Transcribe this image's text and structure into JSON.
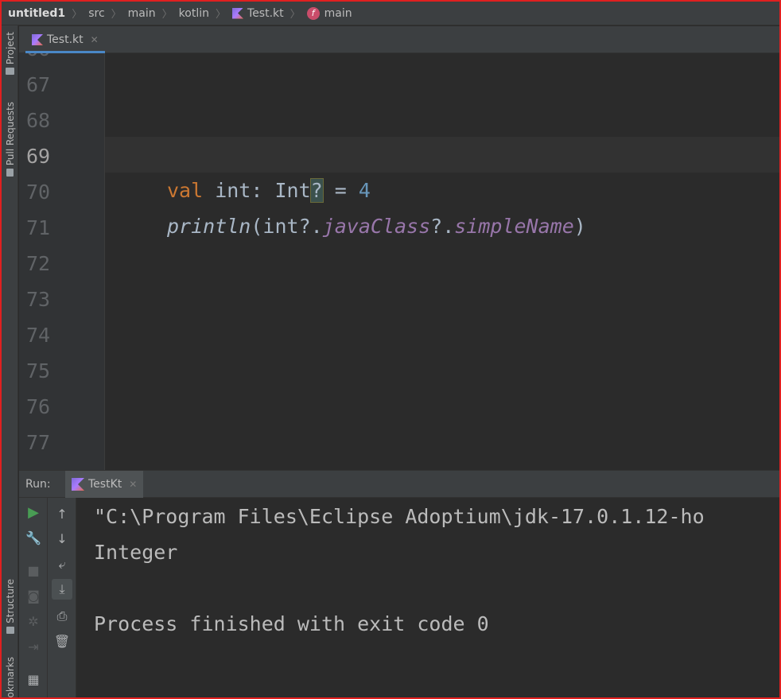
{
  "breadcrumb": {
    "project": "untitled1",
    "items": [
      "src",
      "main",
      "kotlin",
      "Test.kt",
      "main"
    ]
  },
  "left_tool_windows": [
    "Project",
    "Pull Requests",
    "Structure",
    "ookmarks"
  ],
  "editor": {
    "tab_label": "Test.kt",
    "line_numbers": [
      "67",
      "68",
      "69",
      "70",
      "71",
      "72",
      "73",
      "74",
      "75",
      "76",
      "77"
    ],
    "current_line": "69",
    "code": {
      "line70": {
        "kw": "val",
        "name": " int: Int",
        "highlight": "?",
        "rest": " = ",
        "value": "4"
      },
      "line71": {
        "fn": "println",
        "open": "(int?.",
        "prop1": "javaClass",
        "mid": "?.",
        "prop2": "simpleName",
        "close": ")"
      }
    }
  },
  "run_panel": {
    "label": "Run:",
    "tab_label": "TestKt",
    "console_lines": [
      "\"C:\\Program Files\\Eclipse Adoptium\\jdk-17.0.1.12-ho",
      "Integer",
      "",
      "Process finished with exit code 0"
    ]
  },
  "colors": {
    "keyword": "#cc7832",
    "number": "#6897bb",
    "property": "#9876aa",
    "text": "#a9b7c6",
    "border": "#e02020"
  }
}
